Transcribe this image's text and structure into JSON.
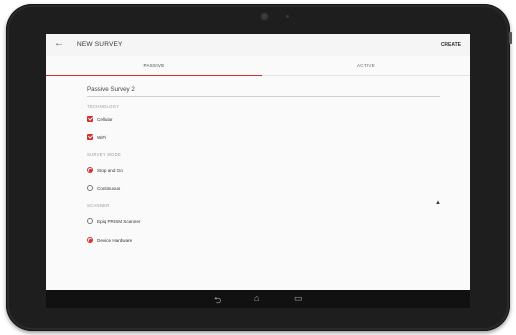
{
  "app": {
    "title": "NEW SURVEY",
    "create_label": "CREATE"
  },
  "tabs": [
    {
      "label": "PASSIVE"
    },
    {
      "label": "ACTIVE"
    }
  ],
  "form": {
    "survey_name": "Passive Survey 2",
    "technology": {
      "label": "TECHNOLOGY",
      "options": [
        {
          "label": "Cellular",
          "checked": true
        },
        {
          "label": "WiFi",
          "checked": true
        }
      ]
    },
    "survey_mode": {
      "label": "SURVEY MODE",
      "options": [
        {
          "label": "Stop and Go",
          "selected": true
        },
        {
          "label": "Continuous",
          "selected": false
        }
      ]
    },
    "scanner": {
      "label": "SCANNER",
      "options": [
        {
          "label": "Epiq PRISM Scanner",
          "selected": false
        },
        {
          "label": "Device Hardware",
          "selected": true
        }
      ]
    }
  },
  "icons": {
    "back": "arrow-left-icon",
    "collapse": "chevron-up-icon",
    "nav_back": "back-icon",
    "nav_home": "home-icon",
    "nav_recents": "recents-icon"
  },
  "colors": {
    "accent": "#d32f2f"
  }
}
